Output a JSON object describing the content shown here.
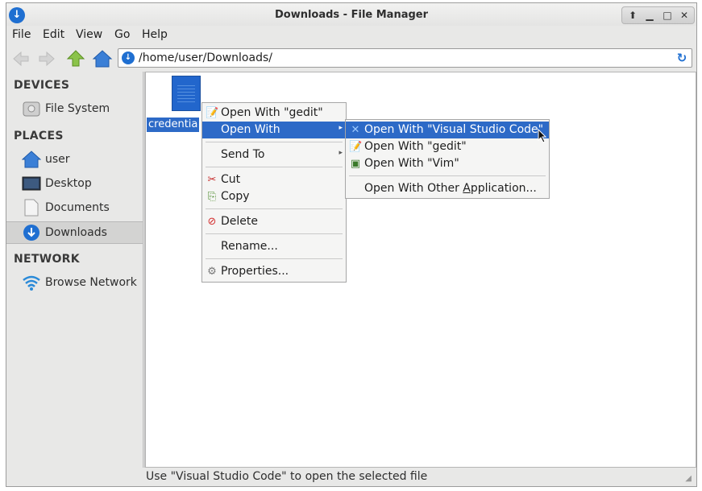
{
  "window": {
    "title": "Downloads - File Manager"
  },
  "menubar": [
    "File",
    "Edit",
    "View",
    "Go",
    "Help"
  ],
  "location": {
    "path": "/home/user/Downloads/"
  },
  "sidebar": {
    "devices_heading": "DEVICES",
    "devices": [
      {
        "label": "File System",
        "icon": "drive-icon"
      }
    ],
    "places_heading": "PLACES",
    "places": [
      {
        "label": "user",
        "icon": "home-icon"
      },
      {
        "label": "Desktop",
        "icon": "desktop-icon"
      },
      {
        "label": "Documents",
        "icon": "document-folder-icon"
      },
      {
        "label": "Downloads",
        "icon": "download-icon",
        "selected": true
      }
    ],
    "network_heading": "NETWORK",
    "network": [
      {
        "label": "Browse Network",
        "icon": "wifi-icon"
      }
    ]
  },
  "file": {
    "name": "credentia",
    "selected": true
  },
  "context_menu": {
    "open_with_gedit": "Open With \"gedit\"",
    "open_with": "Open With",
    "send_to": "Send To",
    "cut": "Cut",
    "copy": "Copy",
    "delete": "Delete",
    "rename": "Rename...",
    "properties": "Properties..."
  },
  "submenu": {
    "vscode": "Open With \"Visual Studio Code\"",
    "gedit": "Open With \"gedit\"",
    "vim": "Open With \"Vim\"",
    "other_prefix": "Open With Other ",
    "other_accel": "A",
    "other_suffix": "pplication..."
  },
  "status": {
    "text": "Use \"Visual Studio Code\" to open the selected file"
  },
  "colors": {
    "selection": "#2d6ac7",
    "accent": "#1f6fd1"
  }
}
